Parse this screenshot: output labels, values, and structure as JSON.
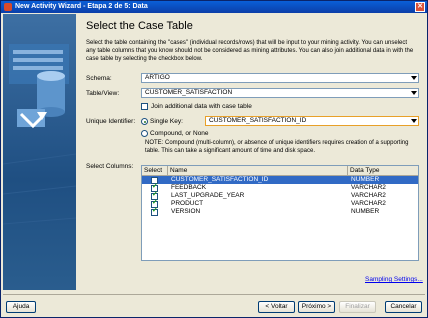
{
  "window": {
    "title": "New Activity Wizard - Etapa 2 de 5: Data"
  },
  "page": {
    "heading": "Select the Case Table",
    "description": "Select the table containing the \"cases\" (individual records/rows) that will be input to your mining activity.  You can unselect any table columns that you know should not be considered as mining attributes.  You can also join additional data in with the case table by selecting the checkbox below."
  },
  "form": {
    "schema_label": "Schema:",
    "schema_value": "ARTIGO",
    "table_label": "Table/View:",
    "table_value": "CUSTOMER_SATISFACTION",
    "join_label": "Join additional data with case table",
    "unique_label": "Unique Identifier:",
    "single_key_label": "Single Key:",
    "single_key_value": "CUSTOMER_SATISFACTION_ID",
    "compound_label": "Compound, or None",
    "note": "NOTE: Compound (multi-column), or absence of unique identifiers requires creation of a supporting table. This can take a significant amount of time and disk space.",
    "select_columns_label": "Select Columns:"
  },
  "columns": {
    "headers": [
      "Select",
      "Name",
      "Data Type"
    ],
    "rows": [
      {
        "name": "CUSTOMER_SATISFACTION_ID",
        "type": "NUMBER",
        "checked": false,
        "selected": true
      },
      {
        "name": "FEEDBACK",
        "type": "VARCHAR2",
        "checked": true,
        "selected": false
      },
      {
        "name": "LAST_UPGRADE_YEAR",
        "type": "VARCHAR2",
        "checked": true,
        "selected": false
      },
      {
        "name": "PRODUCT",
        "type": "VARCHAR2",
        "checked": true,
        "selected": false
      },
      {
        "name": "VERSION",
        "type": "NUMBER",
        "checked": true,
        "selected": false
      }
    ]
  },
  "links": {
    "sampling": "Sampling Settings..."
  },
  "buttons": {
    "help": "Ajuda",
    "back": "< Voltar",
    "next": "Próximo >",
    "finish": "Finalizar",
    "cancel": "Cancelar"
  },
  "colors": {
    "selection": "#316ac5",
    "accent": "#0a246a"
  }
}
